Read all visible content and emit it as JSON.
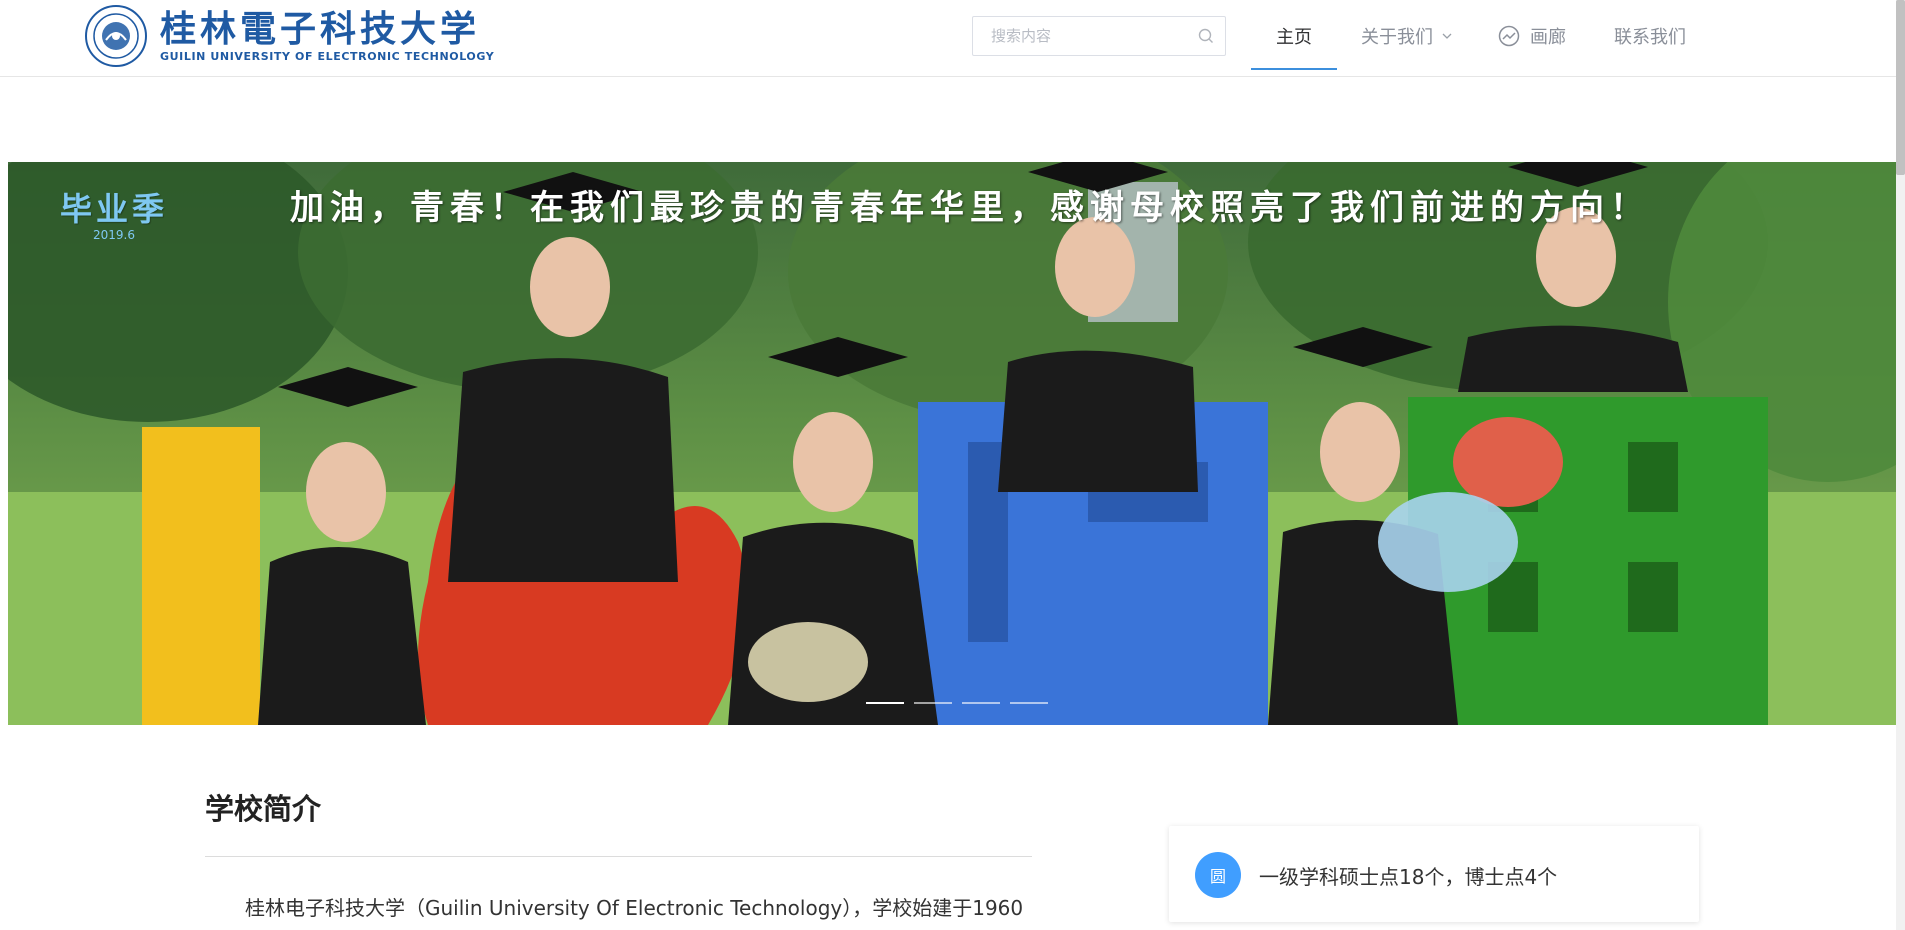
{
  "header": {
    "logo_cn": "桂林電子科技大学",
    "logo_en": "GUILIN UNIVERSITY OF ELECTRONIC TECHNOLOGY",
    "search_placeholder": "搜索内容",
    "nav": [
      {
        "label": "主页",
        "active": true
      },
      {
        "label": "关于我们"
      },
      {
        "label": "画廊"
      },
      {
        "label": "联系我们"
      }
    ]
  },
  "banner": {
    "title": "加油，青春！在我们最珍贵的青春年华里，感谢母校照亮了我们前进的方向！",
    "badge": "毕业季",
    "badge_date": "2019.6",
    "slide_count": 4,
    "active_slide": 1
  },
  "intro": {
    "title": "学校简介",
    "text": "桂林电子科技大学（Guilin University Of Electronic Technology），学校始建于1960"
  },
  "stat": {
    "icon_glyph": "圆",
    "text": "一级学科硕士点18个，博士点4个"
  },
  "colors": {
    "brand_blue": "#1f5aa3",
    "accent": "#3c8fdd",
    "stat_icon": "#409eff"
  }
}
